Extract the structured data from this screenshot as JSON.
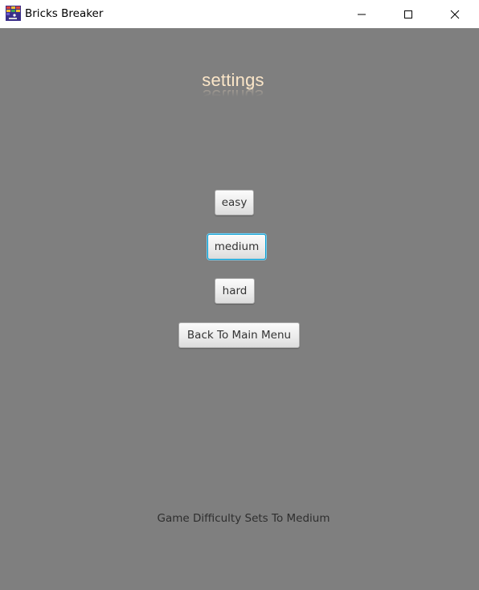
{
  "window": {
    "title": "Bricks Breaker",
    "app_icon": "bricks-breaker-app-icon",
    "controls": {
      "minimize_icon": "minimize-icon",
      "maximize_icon": "maximize-icon",
      "close_icon": "close-icon"
    }
  },
  "settings": {
    "heading": "settings",
    "heading_color": "#fbe6c8",
    "background_color": "#7f7f7f"
  },
  "buttons": {
    "easy": "easy",
    "medium": "medium",
    "hard": "hard",
    "back": "Back To Main Menu",
    "focused": "medium",
    "focus_color": "#039ed3"
  },
  "status": {
    "message": "Game Difficulty Sets To Medium"
  }
}
